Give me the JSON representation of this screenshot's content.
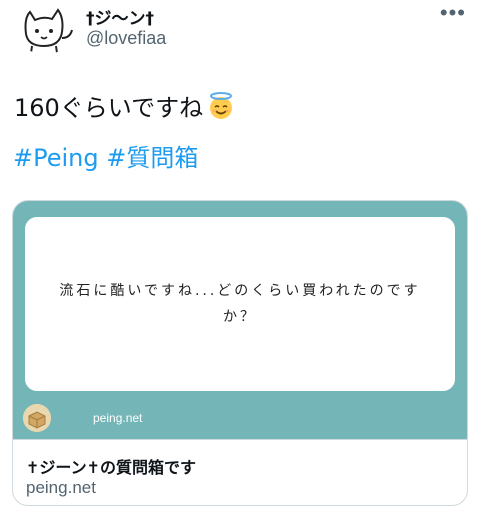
{
  "author": {
    "display_name": "†ジ〜ン†",
    "handle": "@lovefiaa",
    "avatar_icon": "cat-doodle-icon"
  },
  "more_icon": "more-options-icon",
  "tweet": {
    "text": "160ぐらいですね",
    "emoji": "smiling-face-with-halo-icon",
    "hashtags": [
      "#Peing",
      "#質問箱"
    ]
  },
  "card": {
    "image_bg_color": "#74b6b7",
    "question": "流石に酷いですね...どのくらい買われたのですか？",
    "image_domain": "peing.net",
    "title": "✝ジーン✝の質問箱です",
    "domain": "peing.net"
  },
  "colors": {
    "hashtag": "#1d9bf0",
    "secondary_text": "#536471"
  }
}
